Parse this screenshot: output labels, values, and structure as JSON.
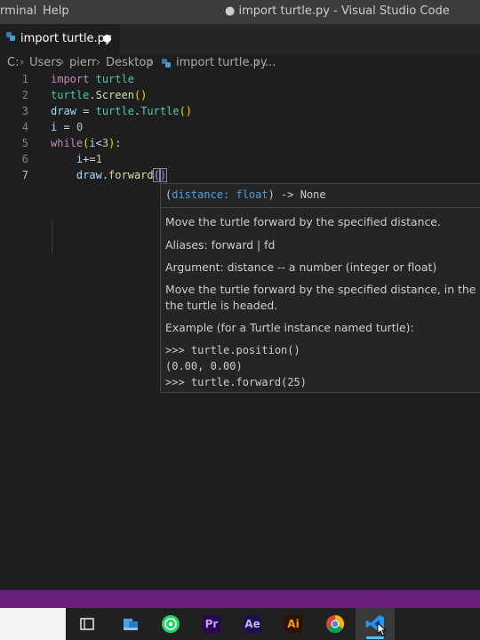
{
  "window": {
    "menu": [
      "rminal",
      "Help"
    ],
    "title": "● import turtle.py - Visual Studio Code"
  },
  "tab": {
    "label": "import turtle.py",
    "dirty": true
  },
  "breadcrumb": [
    "C:",
    "Users",
    "pierr",
    "Desktop",
    "import turtle.py",
    "..."
  ],
  "editor": {
    "line_numbers": [
      "1",
      "2",
      "3",
      "4",
      "5",
      "6",
      "7"
    ],
    "active_line": "7",
    "lines": [
      "import turtle",
      "turtle.Screen()",
      "draw = turtle.Turtle()",
      "i = 0",
      "while(i<3):",
      "    i+=1",
      "    draw.forward()"
    ]
  },
  "hover": {
    "signature_open": "(",
    "param": "distance: float",
    "signature_close": ") -> None",
    "desc1": "Move the turtle forward by the specified distance.",
    "aliases": "Aliases: forward | fd",
    "argument": "Argument: distance -- a number (integer or float)",
    "desc2_line1": "Move the turtle forward by the specified distance, in the direc",
    "desc2_line2": "the turtle is headed.",
    "example_intro": "Example (for a Turtle instance named turtle):",
    "example_code": [
      ">>> turtle.position()",
      "(0.00, 0.00)",
      ">>> turtle.forward(25)"
    ]
  },
  "taskbar": {
    "apps": [
      "task-view",
      "file-explorer",
      "whatsapp",
      "premiere-pro",
      "after-effects",
      "illustrator",
      "chrome",
      "vs-code"
    ],
    "labels": {
      "premiere": "Pr",
      "after_effects": "Ae",
      "illustrator": "Ai"
    },
    "active": "vs-code"
  },
  "colors": {
    "statusbar": "#68217a",
    "editor_bg": "#1e1e1e",
    "keyword": "#c586c0",
    "function": "#dcdcaa",
    "class": "#4ec9b0",
    "variable": "#9cdcfe"
  }
}
